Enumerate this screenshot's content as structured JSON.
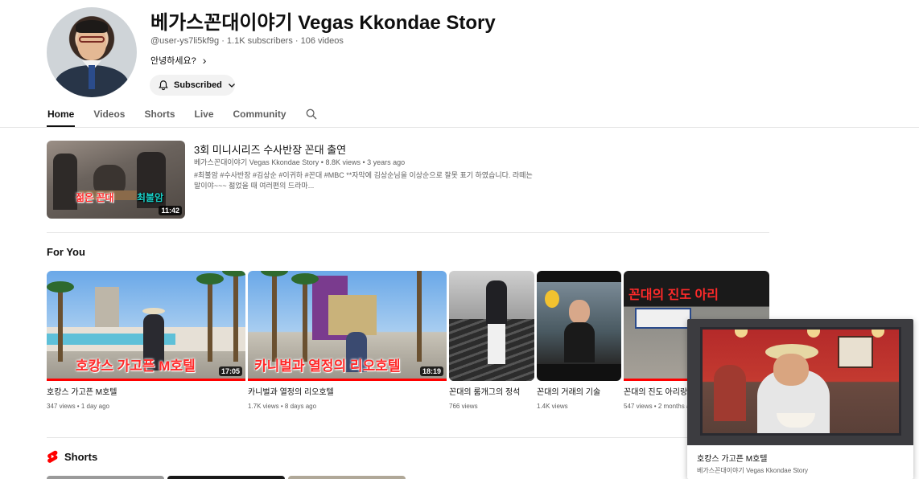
{
  "channel": {
    "name": "베가스꼰대이야기 Vegas Kkondae Story",
    "meta": "@user-ys7li5kf9g · 1.1K subscribers · 106 videos",
    "description": "안녕하세요?",
    "subscribe_label": "Subscribed"
  },
  "tabs": [
    {
      "label": "Home",
      "active": true
    },
    {
      "label": "Videos",
      "active": false
    },
    {
      "label": "Shorts",
      "active": false
    },
    {
      "label": "Live",
      "active": false
    },
    {
      "label": "Community",
      "active": false
    }
  ],
  "featured": {
    "title": "3회 미니시리즈 수사반장 꼰대 출연",
    "meta": "베가스꼰대이야기 Vegas Kkondae Story • 8.8K views • 3 years ago",
    "description": "#최불암 #수사반장 #김상순 #이귀하 #꼰대 #MBC **자막에 김상순님을 이상순으로 잘못 표기 하였습니다. 라떼는 말이야~~~ 젊었을 때 여러편의 드라마...",
    "duration": "11:42",
    "caption_left": "젊은 꼰대",
    "caption_right": "최불암"
  },
  "for_you": {
    "heading": "For You",
    "videos": [
      {
        "title": "호캉스 가고픈 M호텔",
        "meta": "347 views • 1 day ago",
        "duration": "17:05",
        "caption": "호캉스 가고픈 M호텔",
        "progress": 1.0
      },
      {
        "title": "카니벌과 열정의 리오호텔",
        "meta": "1.7K views • 8 days ago",
        "duration": "18:19",
        "caption": "카니벌과 열정의 리오호텔",
        "progress": 1.0
      },
      {
        "title": "꼰대의 룸개그의 정석",
        "meta": "766 views",
        "duration": "",
        "caption": "",
        "progress": 0
      },
      {
        "title": "꼰대의 거래의 기술",
        "meta": "1.4K views",
        "duration": "",
        "caption": "",
        "progress": 0
      },
      {
        "title": "꼰대의 진도 아리랑",
        "meta": "547 views • 2 months ago",
        "duration": "",
        "caption": "꼰대의 진도 아리",
        "progress": 0.6
      }
    ]
  },
  "shorts": {
    "heading": "Shorts"
  },
  "mini_player": {
    "title": "호캉스 가고픈 M호텔",
    "channel": "베가스꼰대이야기 Vegas Kkondae Story"
  },
  "colors": {
    "accent": "#ff0000",
    "text": "#0f0f0f",
    "muted": "#606060",
    "chip": "#f2f2f2"
  },
  "icons": [
    "bell-icon",
    "chevron-down-icon",
    "chevron-right-icon",
    "search-icon",
    "shorts-logo-icon"
  ]
}
